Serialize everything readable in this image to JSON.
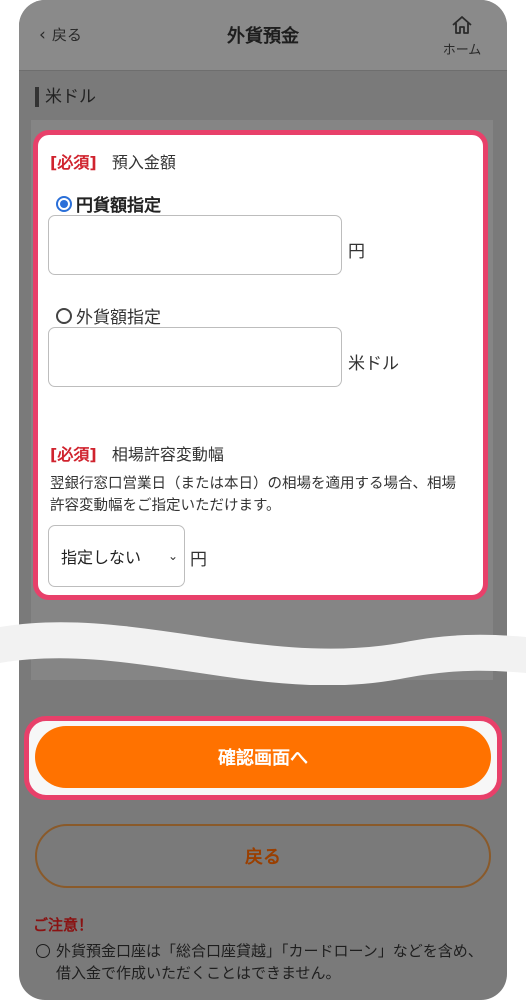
{
  "header": {
    "back_label": "戻る",
    "title": "外貨預金",
    "home_label": "ホーム"
  },
  "section_label": "米ドル",
  "amount": {
    "required": "[必須]",
    "label": "預入金額",
    "options": [
      {
        "label": "円貨額指定",
        "selected": true,
        "unit": "円",
        "value": ""
      },
      {
        "label": "外貨額指定",
        "selected": false,
        "unit": "米ドル",
        "value": ""
      }
    ]
  },
  "tolerance": {
    "required": "[必須]",
    "label": "相場許容変動幅",
    "description": "翌銀行窓口営業日（または本日）の相場を適用する場合、相場許容変動幅をご指定いただけます。",
    "selected": "指定しない",
    "unit": "円"
  },
  "buttons": {
    "confirm": "確認画面へ",
    "back": "戻る"
  },
  "notice": {
    "title": "ご注意！",
    "text": "外貨預金口座は「総合口座貸越」「カードローン」などを含め、借入金で作成いただくことはできません。"
  },
  "colors": {
    "highlight": "#e8406a",
    "primary": "#ff7200",
    "required": "#d0232e"
  }
}
